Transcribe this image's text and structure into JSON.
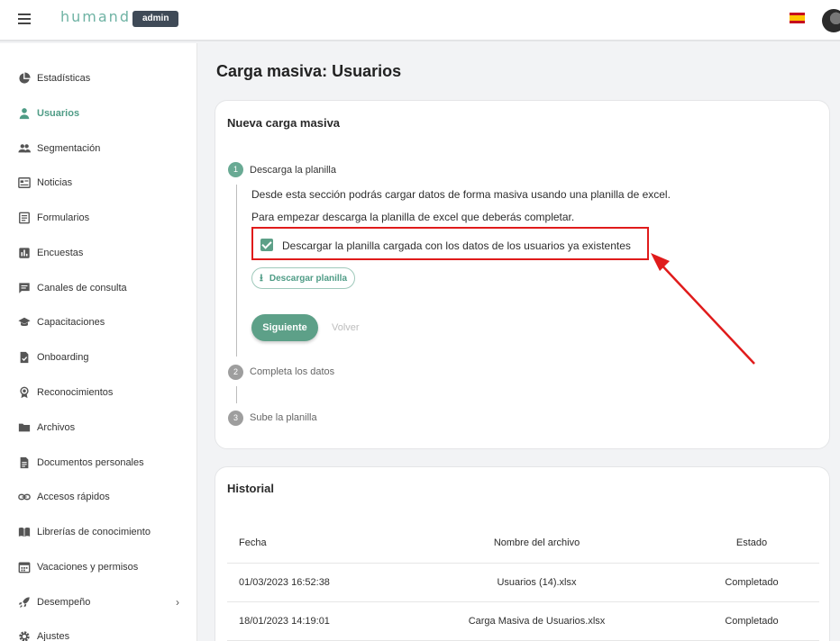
{
  "app": {
    "logo": "humand",
    "badge": "admin",
    "language": "spanish-flag-icon"
  },
  "sidebar": {
    "items": [
      {
        "label": "Estadísticas",
        "icon": "pie-chart-icon",
        "active": false
      },
      {
        "label": "Usuarios",
        "icon": "person-icon",
        "active": true
      },
      {
        "label": "Segmentación",
        "icon": "people-icon",
        "active": false
      },
      {
        "label": "Noticias",
        "icon": "newspaper-icon",
        "active": false
      },
      {
        "label": "Formularios",
        "icon": "form-icon",
        "active": false
      },
      {
        "label": "Encuestas",
        "icon": "poll-icon",
        "active": false
      },
      {
        "label": "Canales de consulta",
        "icon": "chat-icon",
        "active": false
      },
      {
        "label": "Capacitaciones",
        "icon": "graduation-cap-icon",
        "active": false
      },
      {
        "label": "Onboarding",
        "icon": "checklist-icon",
        "active": false
      },
      {
        "label": "Reconocimientos",
        "icon": "award-icon",
        "active": false
      },
      {
        "label": "Archivos",
        "icon": "folder-icon",
        "active": false
      },
      {
        "label": "Documentos personales",
        "icon": "document-icon",
        "active": false
      },
      {
        "label": "Accesos rápidos",
        "icon": "link-icon",
        "active": false
      },
      {
        "label": "Librerías de conocimiento",
        "icon": "book-icon",
        "active": false
      },
      {
        "label": "Vacaciones y permisos",
        "icon": "calendar-icon",
        "active": false
      },
      {
        "label": "Desempeño",
        "icon": "rocket-icon",
        "active": false
      },
      {
        "label": "Ajustes",
        "icon": "gear-icon",
        "active": false
      }
    ]
  },
  "main": {
    "title": "Carga masiva: Usuarios",
    "upload_card": {
      "title": "Nueva carga masiva",
      "steps": [
        {
          "number": "1",
          "label": "Descarga la planilla"
        },
        {
          "number": "2",
          "label": "Completa los datos"
        },
        {
          "number": "3",
          "label": "Sube la planilla"
        }
      ],
      "description_1": "Desde esta sección podrás cargar datos de forma masiva usando una planilla de excel.",
      "description_2": "Para empezar descarga la planilla de excel que deberás completar.",
      "checkbox_label": "Descargar la planilla cargada con los datos de los usuarios ya existentes",
      "checkbox_checked": true,
      "download_button": "Descargar planilla",
      "next_button": "Siguiente",
      "back_button": "Volver"
    },
    "history_card": {
      "title": "Historial",
      "columns": [
        "Fecha",
        "Nombre del archivo",
        "Estado"
      ],
      "rows": [
        [
          "01/03/2023 16:52:38",
          "Usuarios (14).xlsx",
          "Completado"
        ],
        [
          "18/01/2023 14:19:01",
          "Carga Masiva de Usuarios.xlsx",
          "Completado"
        ]
      ]
    }
  },
  "colors": {
    "accent": "#5da088",
    "highlight": "#e01b1b",
    "badge": "#3f4a57"
  }
}
